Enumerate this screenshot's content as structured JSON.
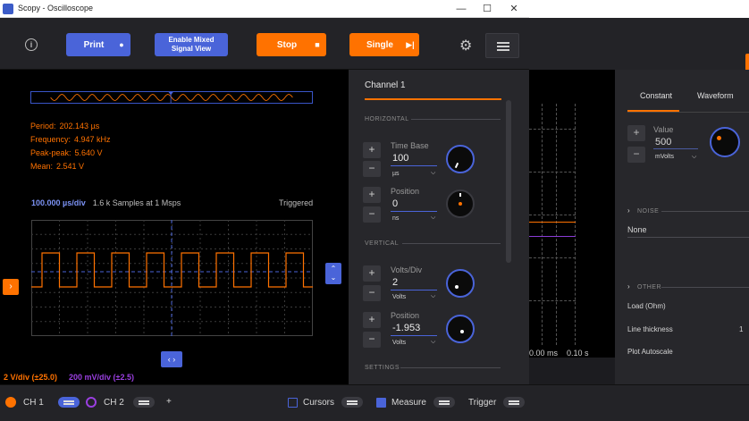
{
  "window": {
    "title": "Scopy - Oscilloscope",
    "min_icon": "—",
    "max_icon": "☐",
    "close_icon": "✕"
  },
  "toolbar": {
    "print_label": "Print",
    "mixed_label_line1": "Enable Mixed",
    "mixed_label_line2": "Signal View",
    "stop_label": "Stop",
    "single_label": "Single"
  },
  "measurements": [
    {
      "key": "Period:",
      "value": "202.143 µs"
    },
    {
      "key": "Frequency:",
      "value": "4.947 kHz"
    },
    {
      "key": "Peak-peak:",
      "value": "5.640 V"
    },
    {
      "key": "Mean:",
      "value": "2.541 V"
    }
  ],
  "plot": {
    "time_per_div": "100.000 µs/div",
    "samples": "1.6 k Samples at 1 Msps",
    "status": "Triggered",
    "ch1_scale": "2 V/div (±25.0)",
    "ch2_scale": "200 mV/div (±2.5)"
  },
  "panel": {
    "title": "Channel 1",
    "horizontal": "HORIZONTAL",
    "vertical": "VERTICAL",
    "settings": "SETTINGS",
    "time_base": {
      "label": "Time Base",
      "value": "100",
      "unit": "µs"
    },
    "h_position": {
      "label": "Position",
      "value": "0",
      "unit": "ns"
    },
    "volts_div": {
      "label": "Volts/Div",
      "value": "2",
      "unit": "Volts"
    },
    "v_position": {
      "label": "Position",
      "value": "-1.953",
      "unit": "Volts"
    }
  },
  "bg_panel": {
    "tab_constant": "Constant",
    "tab_waveform": "Waveform",
    "value_label": "Value",
    "value": "500",
    "value_unit": "mVolts",
    "noise": "NOISE",
    "noise_value": "None",
    "other": "OTHER",
    "load": "Load (Ohm)",
    "line_thickness": "Line thickness",
    "line_thickness_value": "1",
    "plot_autoscale": "Plot Autoscale",
    "time_left": "0.00 ms",
    "time_right": "0.10 s"
  },
  "bottombar": {
    "ch1": "CH 1",
    "ch2": "CH 2",
    "add": "+",
    "cursors": "Cursors",
    "measure": "Measure",
    "trigger": "Trigger"
  },
  "colors": {
    "accent_orange": "#ff7200",
    "accent_blue": "#4a64d9",
    "ch2_purple": "#9a3fe0"
  }
}
